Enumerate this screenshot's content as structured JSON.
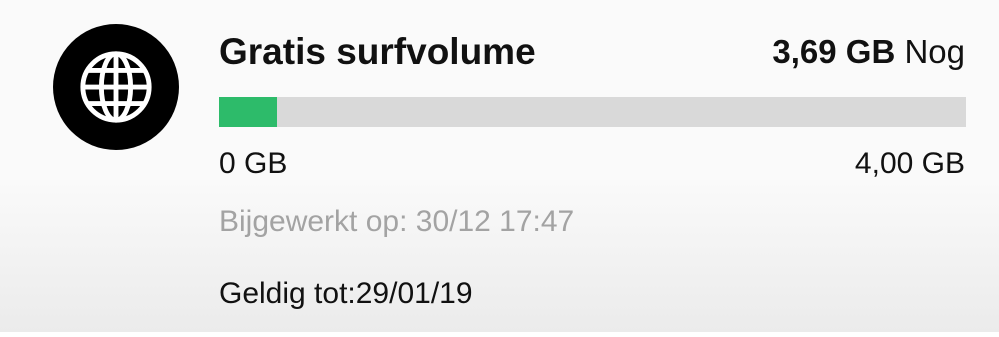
{
  "bundle": {
    "icon": "globe-icon",
    "title": "Gratis surfvolume",
    "remaining_amount": "3,69 GB",
    "remaining_suffix": "Nog",
    "usage_fraction": 0.0775,
    "min_label": "0 GB",
    "max_label": "4,00 GB",
    "updated_text": "Bijgewerkt op: 30/12 17:47",
    "valid_text": "Geldig tot:29/01/19"
  },
  "colors": {
    "progress_fill": "#2dbb6a",
    "progress_track": "#d9d9d9",
    "icon_background": "#000000",
    "icon_foreground": "#ffffff",
    "muted_text": "#a3a3a3"
  }
}
